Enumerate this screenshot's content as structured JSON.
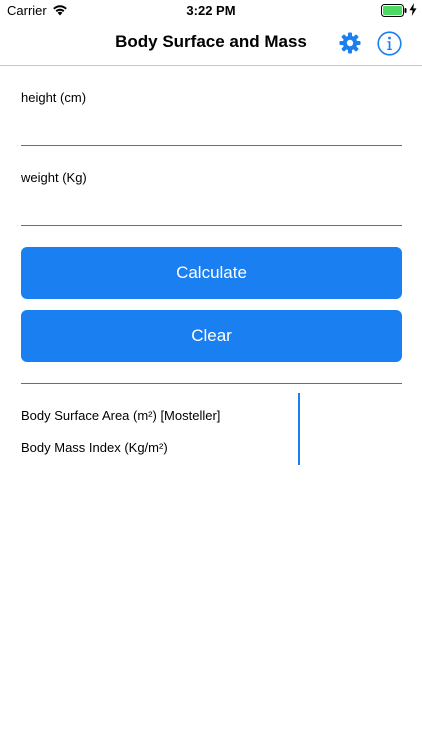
{
  "status_bar": {
    "carrier": "Carrier",
    "time": "3:22 PM",
    "icons": [
      "wifi-icon",
      "battery-icon",
      "charging-icon"
    ]
  },
  "nav": {
    "title": "Body Surface and Mass",
    "icons": [
      "gear-icon",
      "info-icon"
    ]
  },
  "form": {
    "height_label": "height (cm)",
    "height_value": "",
    "weight_label": "weight (Kg)",
    "weight_value": "",
    "calculate_label": "Calculate",
    "clear_label": "Clear"
  },
  "results": {
    "bsa_label": "Body Surface Area (m²) [Mosteller]",
    "bsa_value": "",
    "bmi_label": "Body Mass Index (Kg/m²)",
    "bmi_value": ""
  },
  "colors": {
    "accent": "#1a7ff0",
    "background": "#ffffff",
    "text": "#000000"
  }
}
